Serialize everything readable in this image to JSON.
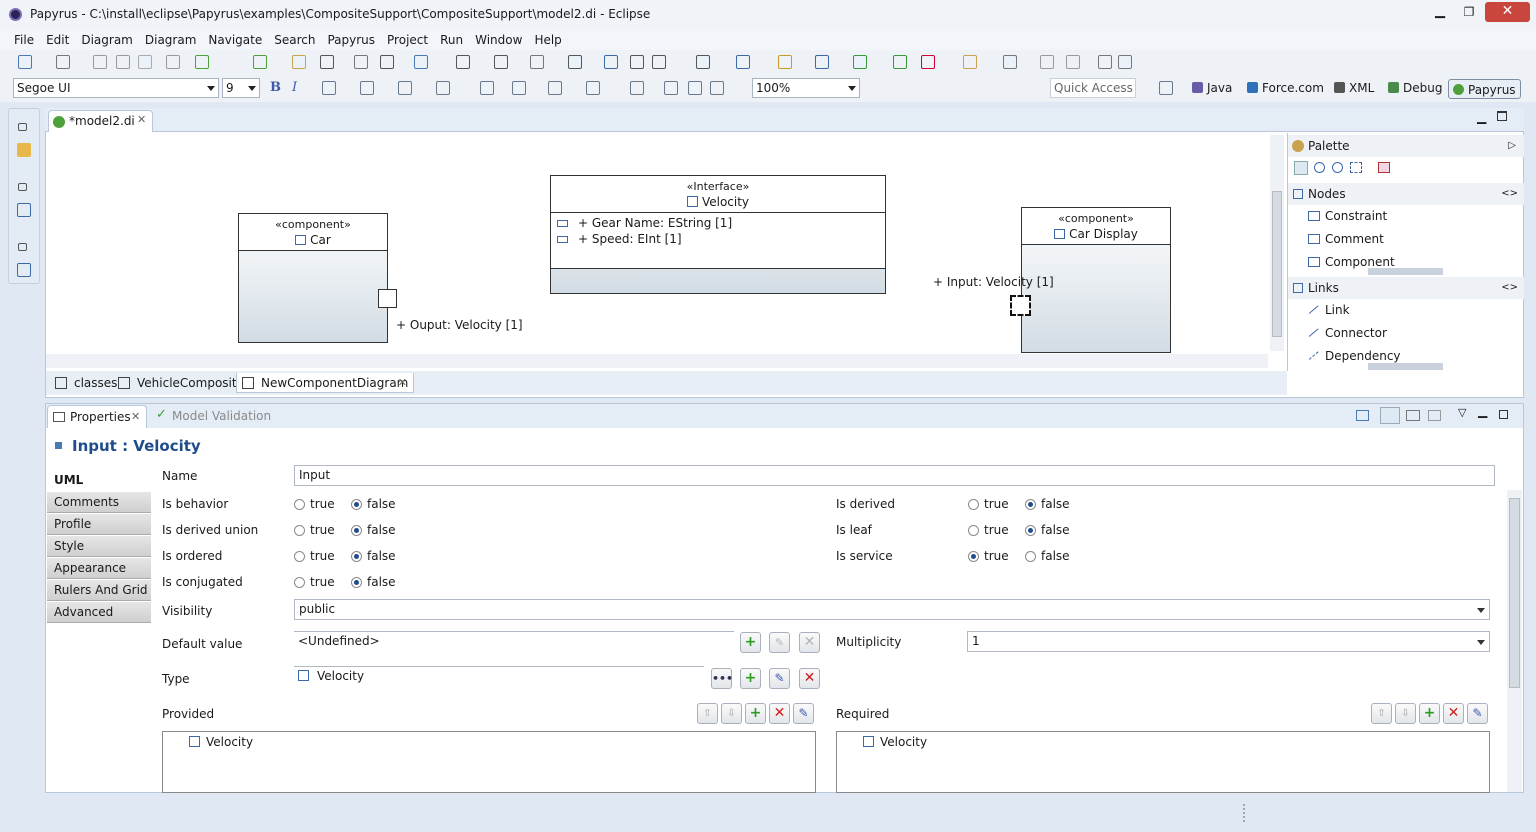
{
  "window": {
    "title": "Papyrus - C:\\install\\eclipse\\Papyrus\\examples\\CompositeSupport\\CompositeSupport\\model2.di - Eclipse"
  },
  "menu": [
    "File",
    "Edit",
    "Diagram",
    "Diagram",
    "Navigate",
    "Search",
    "Papyrus",
    "Project",
    "Run",
    "Window",
    "Help"
  ],
  "toolbar2": {
    "font_name": "Segoe UI",
    "font_size": "9",
    "bold": "B",
    "italic": "I",
    "zoom": "100%",
    "quick_access": "Quick Access"
  },
  "perspectives": [
    "Java",
    "Force.com",
    "XML",
    "Debug",
    "Papyrus"
  ],
  "editor": {
    "tab_label": "*model2.di"
  },
  "diagram": {
    "car": {
      "stereotype": "«component»",
      "name": "Car",
      "port_label": "+ Ouput: Velocity [1]"
    },
    "velocity": {
      "stereotype": "«Interface»",
      "name": "Velocity",
      "attributes": [
        "+ Gear Name: EString [1]",
        "+ Speed: EInt [1]"
      ]
    },
    "car_display": {
      "stereotype": "«component»",
      "name": "Car Display",
      "port_label": "+ Input: Velocity [1]"
    }
  },
  "palette": {
    "title": "Palette",
    "nodes_label": "Nodes",
    "nodes": [
      "Constraint",
      "Comment",
      "Component"
    ],
    "links_label": "Links",
    "links": [
      "Link",
      "Connector",
      "Dependency"
    ]
  },
  "diagram_tabs": [
    "classes",
    "VehicleComposite",
    "NewComponentDiagram"
  ],
  "views": {
    "properties": "Properties",
    "validation": "Model Validation"
  },
  "properties": {
    "title": "Input : Velocity",
    "tabs": [
      "UML",
      "Comments",
      "Profile",
      "Style",
      "Appearance",
      "Rulers And Grid",
      "Advanced"
    ],
    "name_label": "Name",
    "name_value": "Input",
    "true_label": "true",
    "false_label": "false",
    "bools_left": [
      {
        "label": "Is behavior",
        "value": "false"
      },
      {
        "label": "Is derived union",
        "value": "false"
      },
      {
        "label": "Is ordered",
        "value": "false"
      },
      {
        "label": "Is conjugated",
        "value": "false"
      }
    ],
    "bools_right": [
      {
        "label": "Is derived",
        "value": "false"
      },
      {
        "label": "Is leaf",
        "value": "false"
      },
      {
        "label": "Is service",
        "value": "true"
      }
    ],
    "visibility_label": "Visibility",
    "visibility_value": "public",
    "default_label": "Default value",
    "default_value": "<Undefined>",
    "multiplicity_label": "Multiplicity",
    "multiplicity_value": "1",
    "type_label": "Type",
    "type_value": "Velocity",
    "provided_label": "Provided",
    "provided_items": [
      "Velocity"
    ],
    "required_label": "Required",
    "required_items": [
      "Velocity"
    ]
  },
  "colors": {
    "accent": "#1f4c8a",
    "add": "#2d9a22",
    "remove": "#d31c1c"
  }
}
